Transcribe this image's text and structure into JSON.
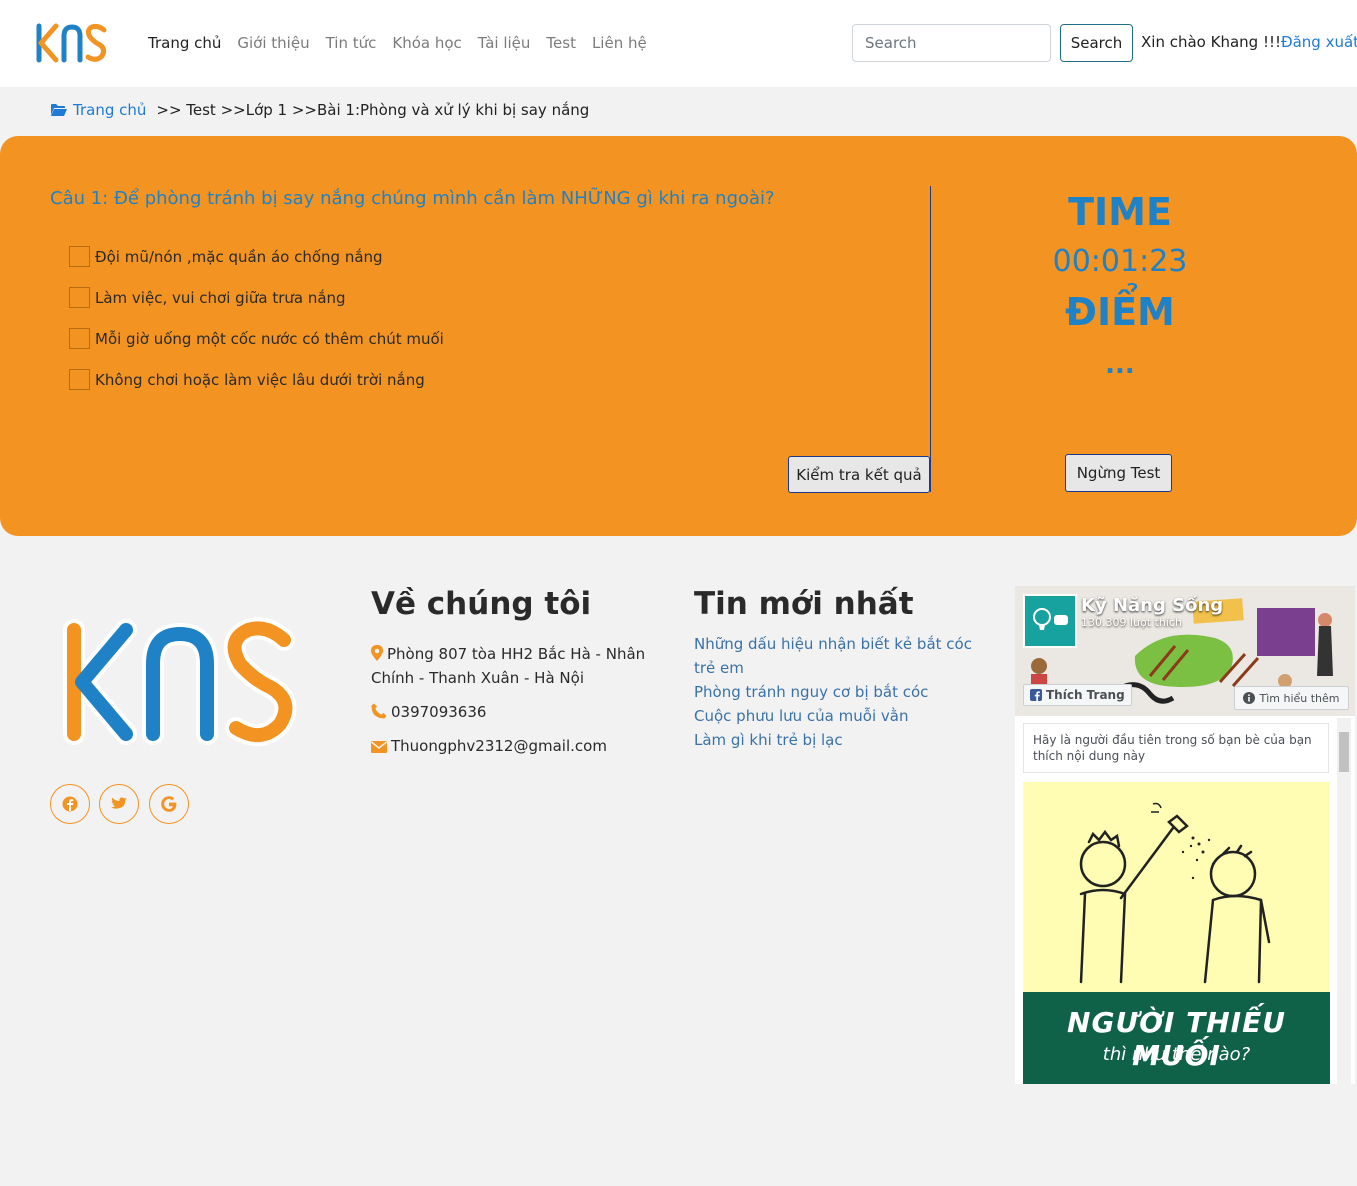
{
  "nav": {
    "links": [
      "Trang chủ",
      "Giới thiệu",
      "Tin tức",
      "Khóa học",
      "Tài liệu",
      "Test",
      "Liên hệ"
    ],
    "search_placeholder": "Search",
    "search_button": "Search",
    "greeting": "Xin chào Khang !!!",
    "logout": "Đăng xuất"
  },
  "breadcrumb": {
    "home": "Trang chủ",
    "trail": ">> Test >>Lớp 1 >>Bài 1:Phòng và xử lý khi bị say nắng"
  },
  "quiz": {
    "question": "Câu 1: Để phòng tránh bị say nắng chúng mình cần làm NHỮNG gì khi ra ngoài?",
    "options": [
      "Đội mũ/nón ,mặc quần áo chống nắng",
      "Làm việc, vui chơi giữa trưa nắng",
      "Mỗi giờ uống một cốc nước có thêm chút muối",
      "Không chơi hoặc làm việc lâu dưới trời nắng"
    ],
    "check_button": "Kiểm tra kết quả",
    "time_label": "TIME",
    "time_value": "00:01:23",
    "score_label": "ĐIỂM",
    "score_value": "...",
    "stop_button": "Ngừng Test"
  },
  "footer": {
    "about_title": "Về chúng tôi",
    "address": "Phòng 807 tòa HH2 Bắc Hà - Nhân Chính - Thanh Xuân - Hà Nội",
    "phone": "0397093636",
    "email": "Thuongphv2312@gmail.com",
    "news_title": "Tin mới nhất",
    "news": [
      "Những dấu hiệu nhận biết kẻ bắt cóc trẻ em",
      "Phòng tránh nguy cơ bị bắt cóc",
      "Cuộc phưu lưu của muỗi vằn",
      "Làm gì khi trẻ bị lạc"
    ]
  },
  "facebook": {
    "page_name": "Kỹ Năng Sống",
    "likes": "130.309 lượt thích",
    "like_button": "Thích Trang",
    "more_button": "Tìm hiểu thêm",
    "friends_text": "Hãy là người đầu tiên trong số bạn bè của bạn thích nội dung này",
    "post_title": "NGƯỜI THIẾU MUỐI",
    "post_subtitle": "thì như thế nào?"
  },
  "colors": {
    "brand_orange": "#f39322",
    "brand_blue": "#1f82c6",
    "link_blue": "#1f7ad6"
  }
}
